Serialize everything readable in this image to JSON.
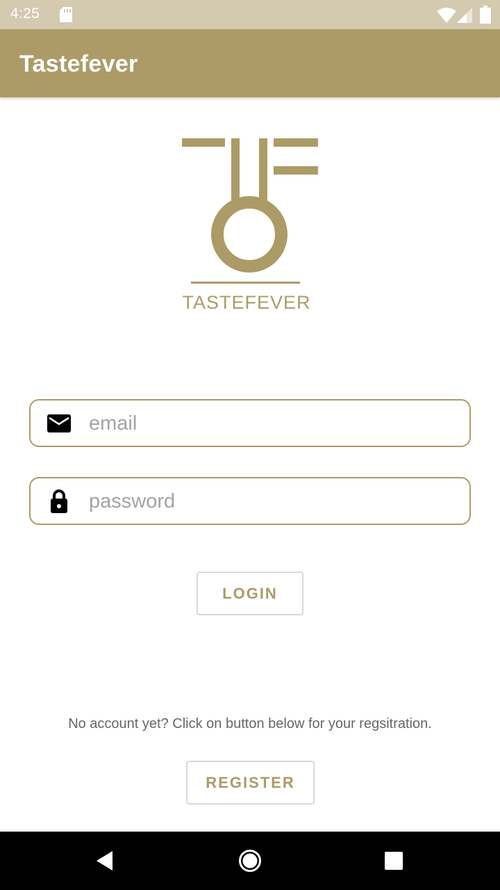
{
  "status_bar": {
    "time": "4:25",
    "icons": [
      "sd-card-icon",
      "wifi-icon",
      "signal-icon",
      "battery-icon"
    ]
  },
  "app_bar": {
    "title": "Tastefever"
  },
  "logo": {
    "text": "TASTEFEVER",
    "color": "#ac9b66"
  },
  "login_form": {
    "email": {
      "icon": "mail-icon",
      "value": "",
      "placeholder": "email"
    },
    "password": {
      "icon": "lock-icon",
      "value": "",
      "placeholder": "password"
    },
    "login_label": "LOGIN"
  },
  "registration": {
    "hint": "No account yet? Click on button below for your regsitration.",
    "register_label": "REGISTER"
  },
  "nav_bar": {
    "icons": [
      "back-icon",
      "home-icon",
      "recents-icon"
    ]
  },
  "colors": {
    "accent": "#ac9b66",
    "status_bar": "#d3cab0",
    "nav_bar": "#000000"
  }
}
